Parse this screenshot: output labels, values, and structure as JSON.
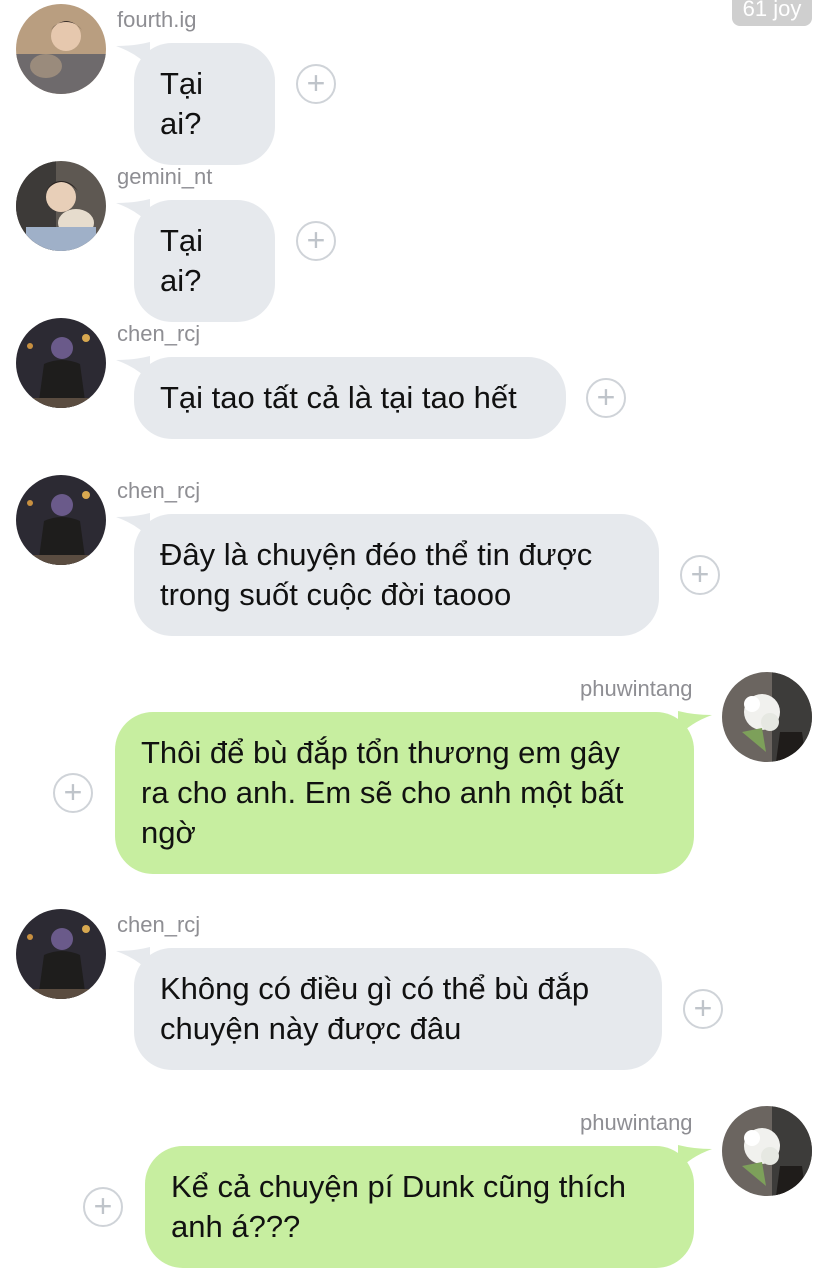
{
  "header": {
    "badge_text": "61 joy"
  },
  "messages": [
    {
      "user": "fourth.ig",
      "text": "Tại ai?",
      "side": "left",
      "avatar_icon": "profile-photo"
    },
    {
      "user": "gemini_nt",
      "text": "Tại ai?",
      "side": "left",
      "avatar_icon": "profile-photo"
    },
    {
      "user": "chen_rcj",
      "text": "Tại tao tất cả là tại tao hết",
      "side": "left",
      "avatar_icon": "profile-photo"
    },
    {
      "user": "chen_rcj",
      "text": "Đây là chuyện đéo thể tin được\ntrong suốt cuộc đời taooo",
      "side": "left",
      "avatar_icon": "profile-photo"
    },
    {
      "user": "phuwintang",
      "text": "Thôi để bù đắp tổn thương em gây\nra cho anh. Em sẽ cho anh một bất\nngờ",
      "side": "right",
      "avatar_icon": "profile-photo"
    },
    {
      "user": "chen_rcj",
      "text": "Không có điều gì có thể bù đắp\nchuyện này được đâu",
      "side": "left",
      "avatar_icon": "profile-photo"
    },
    {
      "user": "phuwintang",
      "text": "Kể cả chuyện pí Dunk cũng thích\nanh á???",
      "side": "right",
      "avatar_icon": "profile-photo"
    }
  ],
  "react_icon": "add-reaction-icon",
  "colors": {
    "bubble_left": "#e6e9ed",
    "bubble_right": "#c7eea0",
    "username": "#8e8e93",
    "react_border": "#cfd3d8"
  }
}
